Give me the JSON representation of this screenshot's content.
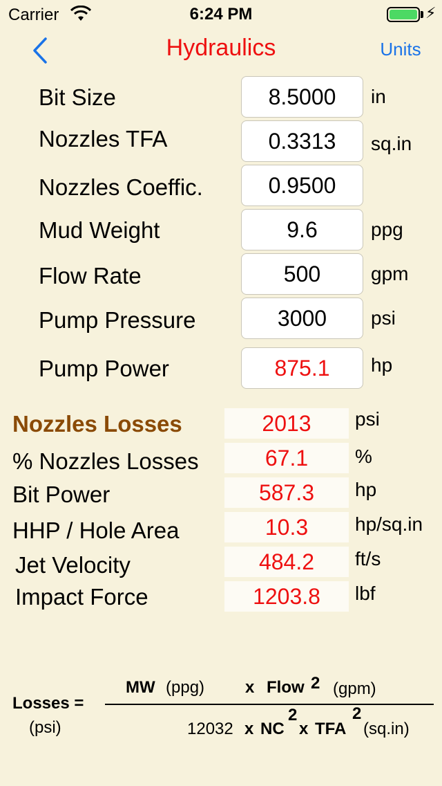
{
  "status_bar": {
    "carrier": "Carrier",
    "time": "6:24 PM"
  },
  "nav": {
    "title": "Hydraulics",
    "units_button": "Units"
  },
  "inputs": [
    {
      "label": "Bit Size",
      "value": "8.5000",
      "unit": "in"
    },
    {
      "label": "Nozzles TFA",
      "value": "0.3313",
      "unit": "sq.in"
    },
    {
      "label": "Nozzles Coeffic.",
      "value": "0.9500",
      "unit": ""
    },
    {
      "label": "Mud Weight",
      "value": "9.6",
      "unit": "ppg"
    },
    {
      "label": "Flow Rate",
      "value": "500",
      "unit": "gpm"
    },
    {
      "label": "Pump Pressure",
      "value": "3000",
      "unit": "psi"
    },
    {
      "label": "Pump Power",
      "value": "875.1",
      "unit": "hp"
    }
  ],
  "results": [
    {
      "label": "Nozzles Losses",
      "value": "2013",
      "unit": "psi"
    },
    {
      "label": "% Nozzles Losses",
      "value": "67.1",
      "unit": "%"
    },
    {
      "label": "Bit Power",
      "value": "587.3",
      "unit": "hp"
    },
    {
      "label": "HHP / Hole Area",
      "value": "10.3",
      "unit": "hp/sq.in"
    },
    {
      "label": "Jet Velocity",
      "value": "484.2",
      "unit": "ft/s"
    },
    {
      "label": "Impact Force",
      "value": "1203.8",
      "unit": "lbf"
    }
  ],
  "formula": {
    "lhs": "Losses =",
    "lhs_unit": "(psi)",
    "num_mw": "MW",
    "num_mw_unit": "(ppg)",
    "num_x": "x",
    "num_flow": "Flow",
    "num_flow_exp": "2",
    "num_flow_unit": "(gpm)",
    "den_const": "12032",
    "den_x1": "x",
    "den_nc": "NC",
    "den_nc_exp": "2",
    "den_x2": "x",
    "den_tfa": "TFA",
    "den_tfa_exp": "2",
    "den_unit": "(sq.in)"
  },
  "colors": {
    "background": "#f7f2dc",
    "accent_red": "#ee1010",
    "link_blue": "#1a73e8",
    "heading_brown": "#8a4a06"
  }
}
